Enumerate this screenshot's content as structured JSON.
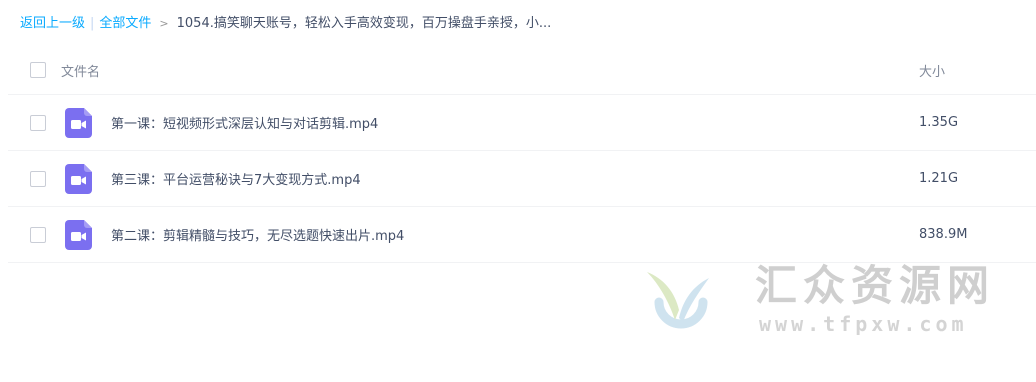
{
  "breadcrumb": {
    "back": "返回上一级",
    "separator": "|",
    "all_files": "全部文件",
    "arrow": ">",
    "current": "1054.搞笑聊天账号，轻松入手高效变现，百万操盘手亲授，小..."
  },
  "list": {
    "header": {
      "name": "文件名",
      "size": "大小"
    },
    "rows": [
      {
        "name": "第一课：短视频形式深层认知与对话剪辑.mp4",
        "size": "1.35G",
        "icon": "video-file-icon"
      },
      {
        "name": "第三课：平台运营秘诀与7大变现方式.mp4",
        "size": "1.21G",
        "icon": "video-file-icon"
      },
      {
        "name": "第二课：剪辑精髓与技巧，无尽选题快速出片.mp4",
        "size": "838.9M",
        "icon": "video-file-icon"
      }
    ]
  },
  "watermark": {
    "title": "汇众资源网",
    "url": "www.tfpxw.com"
  },
  "colors": {
    "link": "#09aaff",
    "text": "#424e67",
    "muted": "#818999",
    "icon": "#7b6ff0"
  }
}
